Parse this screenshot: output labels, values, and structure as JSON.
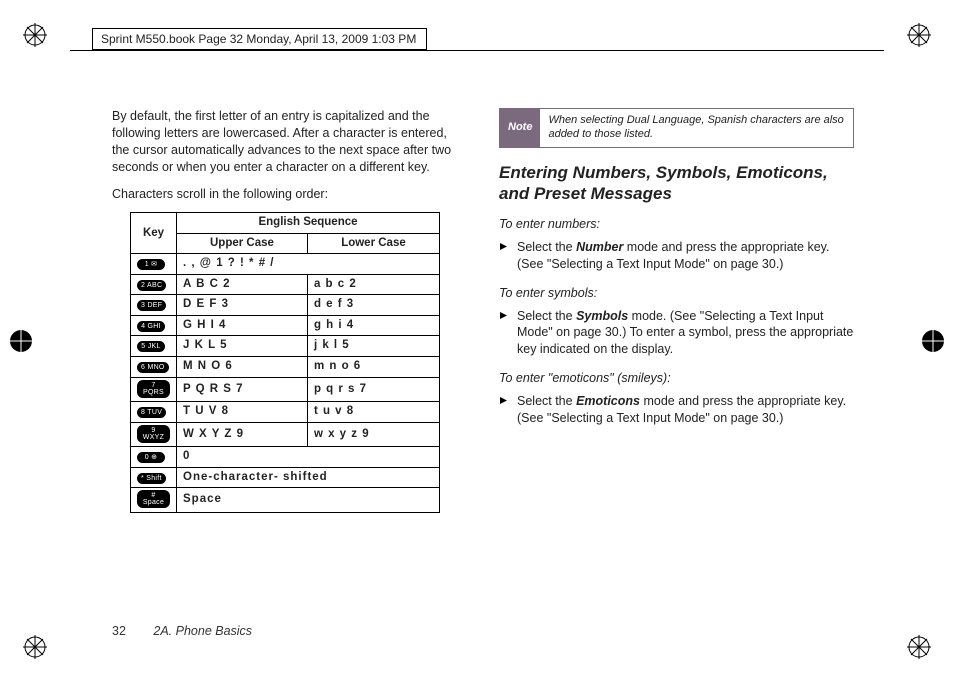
{
  "header": "Sprint M550.book  Page 32  Monday, April 13, 2009  1:03 PM",
  "left": {
    "p1": "By default, the first letter of an entry is capitalized and the following letters are lowercased. After a character is entered, the cursor automatically advances to the next space after two seconds or when you enter a character on a different key.",
    "p2": "Characters scroll in the following order:",
    "table": {
      "key_header": "Key",
      "seq_header": "English Sequence",
      "upper_header": "Upper Case",
      "lower_header": "Lower Case",
      "rows": [
        {
          "cap": "1 ✉",
          "upper": ". , @ 1 ? ! * # /",
          "lower": "",
          "span": true
        },
        {
          "cap": "2 ABC",
          "upper": "A B C 2",
          "lower": "a b c 2"
        },
        {
          "cap": "3 DEF",
          "upper": "D E F 3",
          "lower": "d e f 3"
        },
        {
          "cap": "4 GHI",
          "upper": "G H I 4",
          "lower": "g h i 4"
        },
        {
          "cap": "5 JKL",
          "upper": "J K L 5",
          "lower": "j k l 5"
        },
        {
          "cap": "6 MNO",
          "upper": "M N O 6",
          "lower": "m n o 6"
        },
        {
          "cap": "7 PQRS",
          "upper": "P Q R S 7",
          "lower": "p q r s 7"
        },
        {
          "cap": "8 TUV",
          "upper": "T U V 8",
          "lower": "t u v 8"
        },
        {
          "cap": "9 WXYZ",
          "upper": "W X Y Z 9",
          "lower": "w x y z 9"
        },
        {
          "cap": "0 ⊕",
          "upper": "0",
          "lower": "",
          "span": true
        },
        {
          "cap": "* Shift",
          "upper": "One-character- shifted",
          "lower": "",
          "span": true
        },
        {
          "cap": "# Space",
          "upper": "Space",
          "lower": "",
          "span": true
        }
      ]
    }
  },
  "right": {
    "note_label": "Note",
    "note_text": "When selecting Dual Language, Spanish characters are also added to those listed.",
    "title": "Entering Numbers, Symbols, Emoticons, and Preset Messages",
    "sub1": "To enter numbers:",
    "b1_pre": "Select the ",
    "b1_em": "Number",
    "b1_post": " mode and press the appropriate key. (See \"Selecting a Text Input Mode\" on page 30.)",
    "sub2": "To enter symbols:",
    "b2_pre": "Select the ",
    "b2_em": "Symbols",
    "b2_post": " mode. (See \"Selecting a Text Input Mode\" on page 30.) To enter a symbol, press the appropriate key indicated on the display.",
    "sub3": "To enter \"emoticons\" (smileys):",
    "b3_pre": "Select the ",
    "b3_em": "Emoticons",
    "b3_post": " mode and press the appropriate key. (See \"Selecting a Text Input Mode\" on page 30.)"
  },
  "footer": {
    "page": "32",
    "chapter": "2A. Phone Basics"
  }
}
